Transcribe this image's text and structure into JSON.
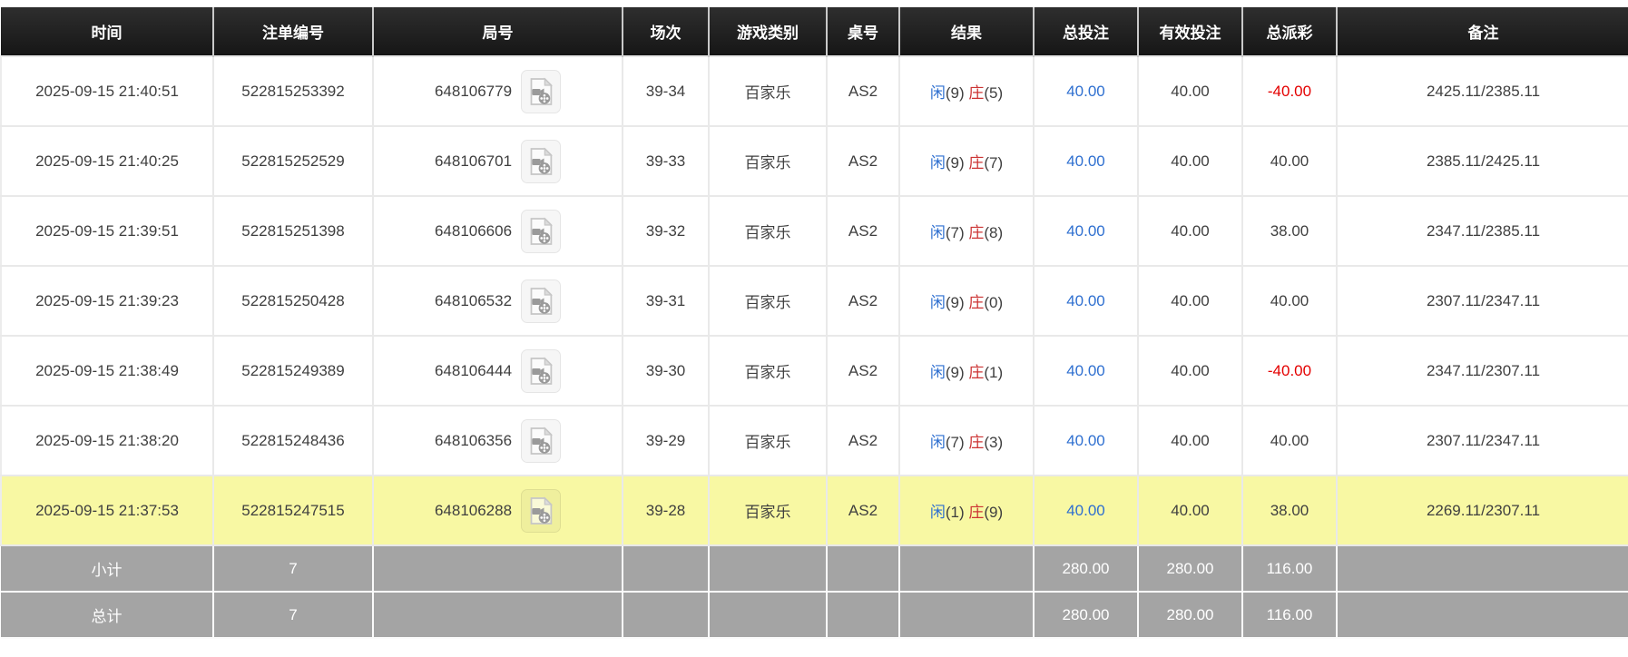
{
  "table": {
    "columns": [
      {
        "key": "time",
        "label": "时间"
      },
      {
        "key": "bet_id",
        "label": "注单编号"
      },
      {
        "key": "round_id",
        "label": "局号"
      },
      {
        "key": "session",
        "label": "场次"
      },
      {
        "key": "game_type",
        "label": "游戏类别"
      },
      {
        "key": "table_no",
        "label": "桌号"
      },
      {
        "key": "result",
        "label": "结果"
      },
      {
        "key": "total_bet",
        "label": "总投注"
      },
      {
        "key": "valid_bet",
        "label": "有效投注"
      },
      {
        "key": "payout",
        "label": "总派彩"
      },
      {
        "key": "remark",
        "label": "备注"
      }
    ],
    "rows": [
      {
        "time": "2025-09-15 21:40:51",
        "bet_id": "522815253392",
        "round_id": "648106779",
        "session": "39-34",
        "game_type": "百家乐",
        "table_no": "AS2",
        "result": {
          "player_label": "闲",
          "player_score": "(9)",
          "banker_label": "庄",
          "banker_score": "(5)"
        },
        "total_bet": "40.00",
        "valid_bet": "40.00",
        "payout": "-40.00",
        "remark": "2425.11/2385.11",
        "highlighted": false
      },
      {
        "time": "2025-09-15 21:40:25",
        "bet_id": "522815252529",
        "round_id": "648106701",
        "session": "39-33",
        "game_type": "百家乐",
        "table_no": "AS2",
        "result": {
          "player_label": "闲",
          "player_score": "(9)",
          "banker_label": "庄",
          "banker_score": "(7)"
        },
        "total_bet": "40.00",
        "valid_bet": "40.00",
        "payout": "40.00",
        "remark": "2385.11/2425.11",
        "highlighted": false
      },
      {
        "time": "2025-09-15 21:39:51",
        "bet_id": "522815251398",
        "round_id": "648106606",
        "session": "39-32",
        "game_type": "百家乐",
        "table_no": "AS2",
        "result": {
          "player_label": "闲",
          "player_score": "(7)",
          "banker_label": "庄",
          "banker_score": "(8)"
        },
        "total_bet": "40.00",
        "valid_bet": "40.00",
        "payout": "38.00",
        "remark": "2347.11/2385.11",
        "highlighted": false
      },
      {
        "time": "2025-09-15 21:39:23",
        "bet_id": "522815250428",
        "round_id": "648106532",
        "session": "39-31",
        "game_type": "百家乐",
        "table_no": "AS2",
        "result": {
          "player_label": "闲",
          "player_score": "(9)",
          "banker_label": "庄",
          "banker_score": "(0)"
        },
        "total_bet": "40.00",
        "valid_bet": "40.00",
        "payout": "40.00",
        "remark": "2307.11/2347.11",
        "highlighted": false
      },
      {
        "time": "2025-09-15 21:38:49",
        "bet_id": "522815249389",
        "round_id": "648106444",
        "session": "39-30",
        "game_type": "百家乐",
        "table_no": "AS2",
        "result": {
          "player_label": "闲",
          "player_score": "(9)",
          "banker_label": "庄",
          "banker_score": "(1)"
        },
        "total_bet": "40.00",
        "valid_bet": "40.00",
        "payout": "-40.00",
        "remark": "2347.11/2307.11",
        "highlighted": false
      },
      {
        "time": "2025-09-15 21:38:20",
        "bet_id": "522815248436",
        "round_id": "648106356",
        "session": "39-29",
        "game_type": "百家乐",
        "table_no": "AS2",
        "result": {
          "player_label": "闲",
          "player_score": "(7)",
          "banker_label": "庄",
          "banker_score": "(3)"
        },
        "total_bet": "40.00",
        "valid_bet": "40.00",
        "payout": "40.00",
        "remark": "2307.11/2347.11",
        "highlighted": false
      },
      {
        "time": "2025-09-15 21:37:53",
        "bet_id": "522815247515",
        "round_id": "648106288",
        "session": "39-28",
        "game_type": "百家乐",
        "table_no": "AS2",
        "result": {
          "player_label": "闲",
          "player_score": "(1)",
          "banker_label": "庄",
          "banker_score": "(9)"
        },
        "total_bet": "40.00",
        "valid_bet": "40.00",
        "payout": "38.00",
        "remark": "2269.11/2307.11",
        "highlighted": true
      }
    ],
    "summary_rows": [
      {
        "label": "小计",
        "count": "7",
        "total_bet": "280.00",
        "valid_bet": "280.00",
        "payout": "116.00"
      },
      {
        "label": "总计",
        "count": "7",
        "total_bet": "280.00",
        "valid_bet": "280.00",
        "payout": "116.00"
      }
    ],
    "icons": {
      "replay": "video-replay-file-icon"
    },
    "colors": {
      "header_bg": "#1f1f1f",
      "player_blue": "#2e6fd0",
      "banker_red": "#cc3333",
      "negative_red": "#e40000",
      "total_bet_blue": "#2e6fd0",
      "highlight_yellow": "#f8f8a3",
      "summary_gray": "#a4a4a4"
    }
  }
}
